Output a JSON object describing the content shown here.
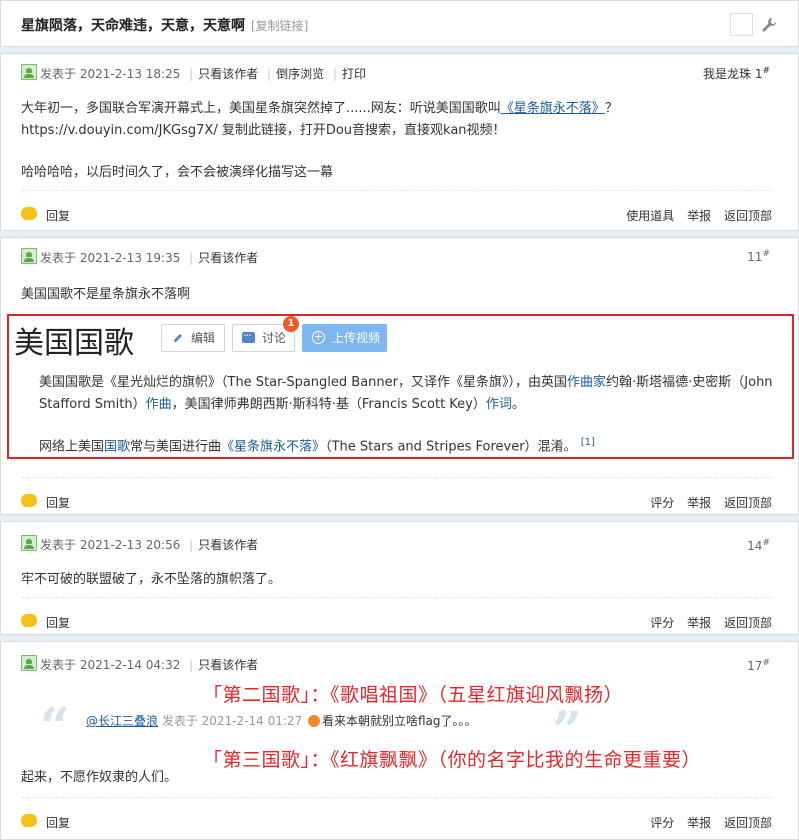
{
  "thread": {
    "title": "星旗陨落，天命难违，天意，天意啊",
    "copy_link": "[复制链接]"
  },
  "labels": {
    "posted_at": "发表于",
    "only_author": "只看该作者",
    "reverse_browse": "倒序浏览",
    "print": "打印",
    "reply": "回复",
    "use_tool": "使用道具",
    "report": "举报",
    "back_top": "返回顶部",
    "rate": "评分"
  },
  "posts": [
    {
      "time": "2021-2-13 18:25",
      "floor_name": "我是龙珠",
      "floor_num": "1",
      "body1_a": "大年初一，多国联合军演开幕式上，美国星条旗突然掉了......网友：听说美国国歌叫",
      "body1_link": "《星条旗永不落》",
      "body1_b": "？ https://v.douyin.com/JKGsg7X/ 复制此链接，打开Dou音搜索，直接观kan视频！",
      "body2": "哈哈哈哈，以后时间久了，会不会被演绎化描写这一幕"
    },
    {
      "time": "2021-2-13 19:35",
      "floor_num": "11",
      "body1": "美国国歌不是星条旗永不落啊"
    },
    {
      "time": "2021-2-13 20:56",
      "floor_num": "14",
      "body1": "牢不可破的联盟破了，永不坠落的旗帜落了。"
    },
    {
      "time": "2021-2-14 04:32",
      "floor_num": "17",
      "body1": "起来，不愿作奴隶的人们。"
    }
  ],
  "baike": {
    "title": "美国国歌",
    "edit": "编辑",
    "discuss": "讨论",
    "badge": "1",
    "upload": "上传视频",
    "p1_a": "美国国歌是《星光灿烂的旗帜》（The Star-Spangled Banner，又译作《星条旗》），由英国",
    "p1_h1": "作曲家",
    "p1_b": "约翰·斯塔福德·史密斯（John Stafford Smith）",
    "p1_h2": "作曲",
    "p1_c": "，美国律师弗朗西斯·斯科特·基（Francis Scott Key）",
    "p1_h3": "作词",
    "p1_d": "。",
    "p2_a": "网络上美国",
    "p2_h1": "国歌",
    "p2_b": "常与美国进行曲",
    "p2_h2": "《星条旗永不落》",
    "p2_c": "（The Stars and Stripes Forever）混淆。",
    "p2_ref": "[1]"
  },
  "quote": {
    "user": "@长江三叠浪",
    "posted": "发表于 2021-2-14 01:27",
    "text": "看来本朝就别立啥flag了。。。"
  },
  "overlay": {
    "line1": "「第二国歌」：《歌唱祖国》（五星红旗迎风飘扬）",
    "line2": "「第三国歌」：《红旗飘飘》（你的名字比我的生命更重要）"
  },
  "colors": {
    "accent_red": "#e8262a",
    "link_blue": "#1a5c9e",
    "upload_blue": "#7eb6ef"
  }
}
